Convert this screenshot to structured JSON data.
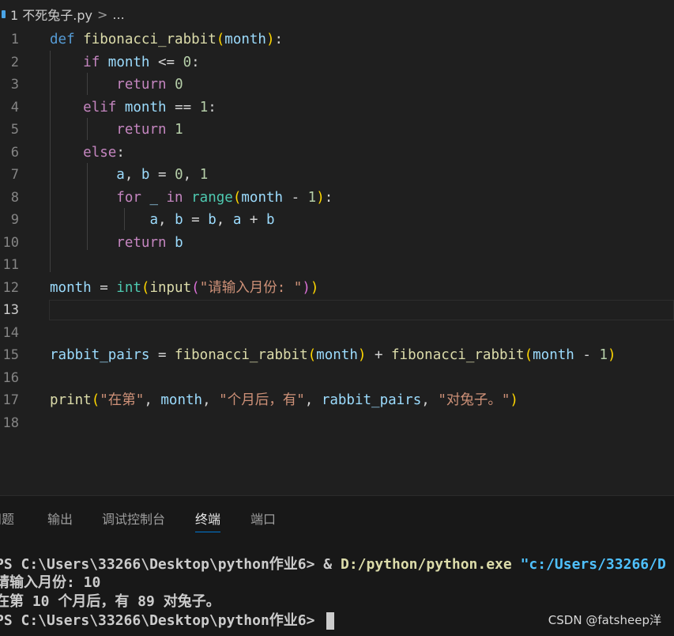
{
  "breadcrumb": {
    "file": "1 不死兔子.py",
    "sep": ">",
    "more": "..."
  },
  "editor": {
    "line_numbers": [
      "1",
      "2",
      "3",
      "4",
      "5",
      "6",
      "7",
      "8",
      "9",
      "10",
      "11",
      "12",
      "13",
      "14",
      "15",
      "16",
      "17",
      "18"
    ],
    "active_line": "13",
    "lines": {
      "l1": {
        "kw": "def",
        "name": "fibonacci_rabbit",
        "open": "(",
        "param": "month",
        "close": ")",
        "colon": ":"
      },
      "l2": {
        "kw": "if",
        "var": "month",
        "op": " <= ",
        "num": "0",
        "colon": ":"
      },
      "l3": {
        "kw": "return",
        "num": "0"
      },
      "l4": {
        "kw": "elif",
        "var": "month",
        "op": " == ",
        "num": "1",
        "colon": ":"
      },
      "l5": {
        "kw": "return",
        "num": "1"
      },
      "l6": {
        "kw": "else",
        "colon": ":"
      },
      "l7": {
        "a": "a",
        "comma1": ", ",
        "b": "b",
        "op": " = ",
        "n0": "0",
        "comma2": ", ",
        "n1": "1"
      },
      "l8": {
        "kw": "for",
        "us": " _ ",
        "in": "in",
        "fn": "range",
        "open": "(",
        "var": "month",
        "op": " - ",
        "num": "1",
        "close": ")",
        "colon": ":"
      },
      "l9": {
        "a": "a",
        "c1": ", ",
        "b": "b",
        "op": " = ",
        "b2": "b",
        "c2": ", ",
        "a2": "a",
        "plus": " + ",
        "b3": "b"
      },
      "l10": {
        "kw": "return",
        "var": "b"
      },
      "l12": {
        "var": "month",
        "op": " = ",
        "fn1": "int",
        "o1": "(",
        "fn2": "input",
        "o2": "(",
        "str": "\"请输入月份: \"",
        "c2": ")",
        "c1": ")"
      },
      "l15": {
        "var": "rabbit_pairs",
        "op": " = ",
        "fn1": "fibonacci_rabbit",
        "o1": "(",
        "arg1": "month",
        "c1": ")",
        "plus": " + ",
        "fn2": "fibonacci_rabbit",
        "o2": "(",
        "arg2": "month",
        "minus": " - ",
        "num": "1",
        "c2": ")"
      },
      "l17": {
        "fn": "print",
        "open": "(",
        "s1": "\"在第\"",
        "c1": ", ",
        "v1": "month",
        "c2": ", ",
        "s2": "\"个月后，有\"",
        "c3": ", ",
        "v2": "rabbit_pairs",
        "c4": ", ",
        "s3": "\"对兔子。\"",
        "close": ")"
      }
    }
  },
  "panel": {
    "tabs": [
      "问题",
      "输出",
      "调试控制台",
      "终端",
      "端口"
    ],
    "active_tab": "终端"
  },
  "terminal": {
    "line1_prompt": "PS C:\\Users\\33266\\Desktop\\python作业6> ",
    "line1_amp": "& ",
    "line1_exe": "D:/python/python.exe ",
    "line1_path": "\"c:/Users/33266/D",
    "line2": "请输入月份: 10",
    "line3": "在第 10 个月后，有 89 对兔子。",
    "line4_prompt": "PS C:\\Users\\33266\\Desktop\\python作业6> "
  },
  "watermark": "CSDN @fatsheep洋"
}
